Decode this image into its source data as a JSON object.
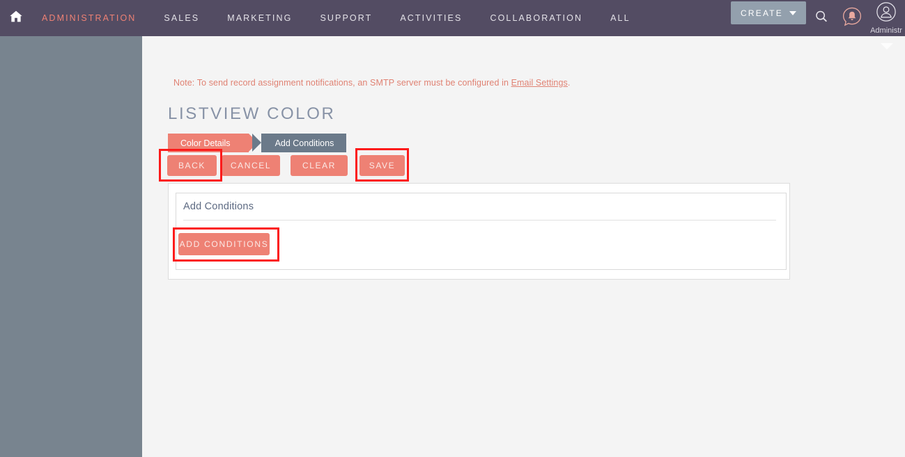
{
  "topnav": {
    "home_icon": "home-icon",
    "items": [
      {
        "label": "ADMINISTRATION",
        "active": true
      },
      {
        "label": "SALES",
        "active": false
      },
      {
        "label": "MARKETING",
        "active": false
      },
      {
        "label": "SUPPORT",
        "active": false
      },
      {
        "label": "ACTIVITIES",
        "active": false
      },
      {
        "label": "COLLABORATION",
        "active": false
      },
      {
        "label": "ALL",
        "active": false
      }
    ],
    "create_label": "CREATE",
    "search_icon": "search-icon",
    "notification_icon": "notification-bell-icon",
    "avatar_icon": "user-avatar-icon",
    "avatar_name": "Administr"
  },
  "sidebar": {
    "toggle_icon": "collapse-left-triangle-icon"
  },
  "main": {
    "dropdown_caret_icon": "chevron-down-icon",
    "note": {
      "prefix": "Note: To send record assignment notifications, an SMTP server must be configured in ",
      "link": "Email Settings",
      "suffix": "."
    },
    "page_title": "LISTVIEW COLOR",
    "steps": [
      {
        "label": "Color Details",
        "state": "done"
      },
      {
        "label": "Add Conditions",
        "state": "current"
      }
    ],
    "actions": {
      "back": "BACK",
      "cancel": "CANCEL",
      "clear": "CLEAR",
      "save": "SAVE"
    },
    "panel": {
      "heading": "Add Conditions",
      "add_conditions_label": "ADD CONDITIONS"
    }
  },
  "colors": {
    "topbar": "#534c63",
    "accent_salmon": "#ee8174",
    "sidebar_slate": "#78848f",
    "step_current_gray": "#6b7a8a",
    "create_button": "#93a0ad",
    "highlight_red": "#fc1a1a",
    "page_bg": "#f4f4f4",
    "title_text": "#8792a6"
  }
}
